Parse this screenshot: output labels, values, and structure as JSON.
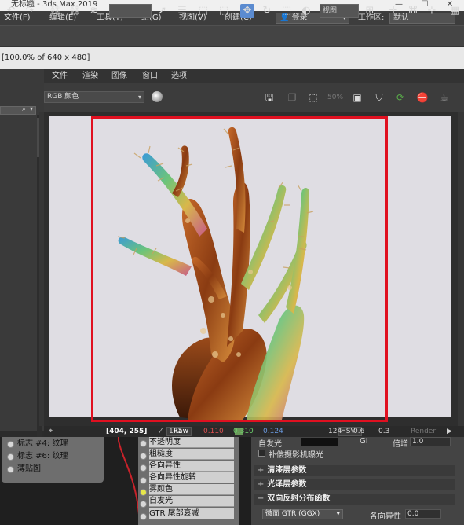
{
  "app": {
    "title": "无标题 - 3ds Max 2019"
  },
  "menubar": {
    "items": [
      "文件(F)",
      "编辑(E)",
      "工具(T)",
      "组(G)",
      "视图(V)",
      "创建(C)"
    ],
    "login": "登录",
    "workspace_label": "工作区:",
    "workspace_value": "默认"
  },
  "toolbar": {
    "view_dropdown": "视图"
  },
  "status_line": "[100.0% of 640 x 480]",
  "frame_window": {
    "menu": [
      "文件",
      "渲染",
      "图像",
      "窗口",
      "选项"
    ],
    "channel": "RGB 颜色",
    "ratio": "50%",
    "status": {
      "coords": "[404, 255]",
      "zoom": "1x1",
      "mode": "Raw",
      "r": "0.110",
      "g": "0.310",
      "b": "0.124",
      "color_space": "HSV",
      "h": "124",
      "s": "0.6",
      "v": "0.3",
      "render_btn": "Render"
    }
  },
  "material_nodes": {
    "node1": [
      "标志 #4: 纹理",
      "标志 #6: 纹理",
      "薄贴图"
    ],
    "node2": [
      "不透明度",
      "粗糙度",
      "各向异性",
      "各向异性旋转",
      "雾颜色",
      "自发光",
      "GTR 尾部衰减"
    ]
  },
  "params": {
    "emissive_label": "自发光",
    "gi_label": "GI",
    "multiplier_label": "倍增",
    "multiplier_value": "1.0",
    "comp_exposure": "补偿摄影机曝光",
    "sections": [
      "清漆层参数",
      "光泽层参数",
      "双向反射分布函数"
    ],
    "brdf_type": "微面 GTR (GGX)",
    "anisotropy_label": "各向异性",
    "anisotropy_value": "0.0"
  },
  "colors": {
    "accent_frame": "#e01020",
    "active_tool": "#5b8bd0"
  }
}
